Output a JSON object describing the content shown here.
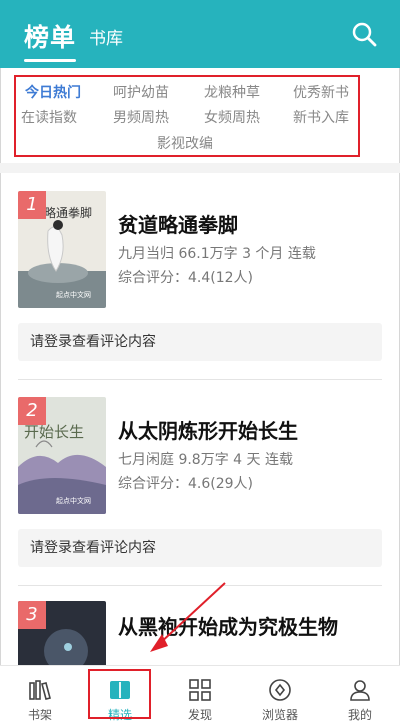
{
  "header": {
    "title": "榜单",
    "tab_library": "书库"
  },
  "categories": [
    "今日热门",
    "呵护幼苗",
    "龙粮种草",
    "优秀新书",
    "在读指数",
    "男频周热",
    "女频周热",
    "新书入库",
    "影视改编"
  ],
  "books": [
    {
      "rank": "1",
      "title": "贫道略通拳脚",
      "meta": "九月当归  66.1万字  3 个月  连载",
      "rating": "综合评分：4.4(12人)",
      "comment": "请登录查看评论内容"
    },
    {
      "rank": "2",
      "title": "从太阴炼形开始长生",
      "meta": "七月闲庭  9.8万字  4 天  连载",
      "rating": "综合评分：4.6(29人)",
      "comment": "请登录查看评论内容"
    },
    {
      "rank": "3",
      "title": "从黑袍开始成为究极生物",
      "meta": "",
      "rating": "",
      "comment": ""
    }
  ],
  "nav": {
    "shelf": "书架",
    "picks": "精选",
    "discover": "发现",
    "browser": "浏览器",
    "me": "我的"
  },
  "colors": {
    "brand": "#26b3bd",
    "active_category": "#3e7bd4",
    "rank_badge": "#e96a6a",
    "highlight": "#e0202a"
  }
}
